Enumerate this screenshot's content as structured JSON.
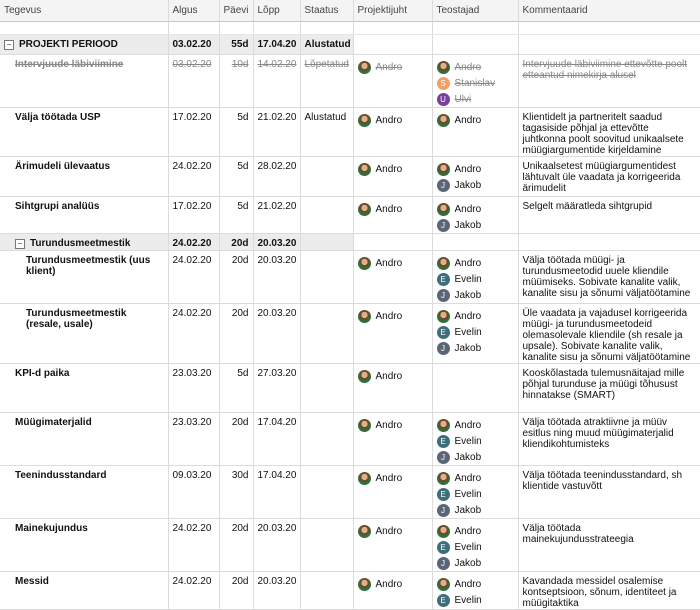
{
  "columns": [
    "Tegevus",
    "Algus",
    "Päevi",
    "Lõpp",
    "Staatus",
    "Projektijuht",
    "Teostajad",
    "Kommentaarid"
  ],
  "rows": [
    {
      "task": "PROJEKTI PERIOOD",
      "start": "03.02.20",
      "days": "55d",
      "end": "17.04.20",
      "status": "Alustatud",
      "pm": "",
      "doers": [],
      "comment": "",
      "indent": 0,
      "group": true,
      "toggle": "−"
    },
    {
      "task": "Intervjuude läbiviimine",
      "start": "03.02.20",
      "days": "10d",
      "end": "14.02.20",
      "status": "Lõpetatud",
      "pm": "Andro",
      "doers": [
        {
          "name": "Andro",
          "av": "photo",
          "letter": ""
        },
        {
          "name": "Stanislav",
          "av": "s",
          "letter": "S"
        },
        {
          "name": "Ulvi",
          "av": "u",
          "letter": "U"
        }
      ],
      "comment": "Intervjuude läbiviimine ettevõtte poolt etteantud nimekirja alusel",
      "indent": 1,
      "done": true
    },
    {
      "task": "Välja töötada USP",
      "start": "17.02.20",
      "days": "5d",
      "end": "21.02.20",
      "status": "Alustatud",
      "pm": "Andro",
      "doers": [
        {
          "name": "Andro",
          "av": "photo",
          "letter": ""
        }
      ],
      "comment": "Klientidelt ja partneritelt saadud tagasiside põhjal ja ettevõtte juhtkonna poolt soovitud unikaalsete müügiargumentide kirjeldamine",
      "indent": 1
    },
    {
      "task": "Ärimudeli ülevaatus",
      "start": "24.02.20",
      "days": "5d",
      "end": "28.02.20",
      "status": "",
      "pm": "Andro",
      "doers": [
        {
          "name": "Andro",
          "av": "photo",
          "letter": ""
        },
        {
          "name": "Jakob",
          "av": "j",
          "letter": "J"
        }
      ],
      "comment": "Unikaalsetest müügiargumentidest lähtuvalt üle vaadata ja korrigeerida ärimudelit",
      "indent": 1
    },
    {
      "task": "Sihtgrupi analüüs",
      "start": "17.02.20",
      "days": "5d",
      "end": "21.02.20",
      "status": "",
      "pm": "Andro",
      "doers": [
        {
          "name": "Andro",
          "av": "photo",
          "letter": ""
        },
        {
          "name": "Jakob",
          "av": "j",
          "letter": "J"
        }
      ],
      "comment": "Selgelt määratleda sihtgrupid",
      "indent": 1
    },
    {
      "task": "Turundusmeetmestik",
      "start": "24.02.20",
      "days": "20d",
      "end": "20.03.20",
      "status": "",
      "pm": "",
      "doers": [],
      "comment": "",
      "indent": 1,
      "group": true,
      "toggle": "−"
    },
    {
      "task": "Turundusmeetmestik (uus klient)",
      "start": "24.02.20",
      "days": "20d",
      "end": "20.03.20",
      "status": "",
      "pm": "Andro",
      "doers": [
        {
          "name": "Andro",
          "av": "photo",
          "letter": ""
        },
        {
          "name": "Evelin",
          "av": "e",
          "letter": "E"
        },
        {
          "name": "Jakob",
          "av": "j",
          "letter": "J"
        }
      ],
      "comment": "Välja töötada müügi- ja turundusmeetodid uuele kliendile müümiseks. Sobivate kanalite valik, kanalite sisu ja sõnumi väljatöötamine",
      "indent": 2
    },
    {
      "task": "Turundusmeetmestik (resale, usale)",
      "start": "24.02.20",
      "days": "20d",
      "end": "20.03.20",
      "status": "",
      "pm": "Andro",
      "doers": [
        {
          "name": "Andro",
          "av": "photo",
          "letter": ""
        },
        {
          "name": "Evelin",
          "av": "e",
          "letter": "E"
        },
        {
          "name": "Jakob",
          "av": "j",
          "letter": "J"
        }
      ],
      "comment": "Üle vaadata ja vajadusel korrigeerida müügi- ja turundusmeetodeid olemasolevale kliendile (sh resale ja upsale). Sobivate kanalite valik, kanalite sisu ja sõnumi väljatöötamine",
      "indent": 2
    },
    {
      "task": "KPI-d paika",
      "start": "23.03.20",
      "days": "5d",
      "end": "27.03.20",
      "status": "",
      "pm": "Andro",
      "doers": [],
      "comment": "Kooskõlastada tulemusnäitajad mille põhjal turunduse ja müügi tõhusust hinnatakse (SMART)",
      "indent": 1
    },
    {
      "task": "Müügimaterjalid",
      "start": "23.03.20",
      "days": "20d",
      "end": "17.04.20",
      "status": "",
      "pm": "Andro",
      "doers": [
        {
          "name": "Andro",
          "av": "photo",
          "letter": ""
        },
        {
          "name": "Evelin",
          "av": "e",
          "letter": "E"
        },
        {
          "name": "Jakob",
          "av": "j",
          "letter": "J"
        }
      ],
      "comment": "Välja töötada atraktiivne ja müüv esitlus ning muud müügimaterjalid kliendikohtumisteks",
      "indent": 1
    },
    {
      "task": "Teenindusstandard",
      "start": "09.03.20",
      "days": "30d",
      "end": "17.04.20",
      "status": "",
      "pm": "Andro",
      "doers": [
        {
          "name": "Andro",
          "av": "photo",
          "letter": ""
        },
        {
          "name": "Evelin",
          "av": "e",
          "letter": "E"
        },
        {
          "name": "Jakob",
          "av": "j",
          "letter": "J"
        }
      ],
      "comment": "Välja töötada teenindusstandard, sh klientide vastuvõtt",
      "indent": 1
    },
    {
      "task": "Mainekujundus",
      "start": "24.02.20",
      "days": "20d",
      "end": "20.03.20",
      "status": "",
      "pm": "Andro",
      "doers": [
        {
          "name": "Andro",
          "av": "photo",
          "letter": ""
        },
        {
          "name": "Evelin",
          "av": "e",
          "letter": "E"
        },
        {
          "name": "Jakob",
          "av": "j",
          "letter": "J"
        }
      ],
      "comment": "Välja töötada mainekujundusstrateegia",
      "indent": 1
    },
    {
      "task": "Messid",
      "start": "24.02.20",
      "days": "20d",
      "end": "20.03.20",
      "status": "",
      "pm": "Andro",
      "doers": [
        {
          "name": "Andro",
          "av": "photo",
          "letter": ""
        },
        {
          "name": "Evelin",
          "av": "e",
          "letter": "E"
        }
      ],
      "comment": "Kavandada messidel osalemise kontseptsioon, sõnum, identiteet ja müügitaktika",
      "indent": 1
    }
  ]
}
